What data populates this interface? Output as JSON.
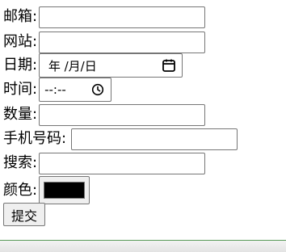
{
  "form": {
    "email_label": "邮箱:",
    "email_value": "",
    "website_label": "网站:",
    "website_value": "",
    "date_label": "日期:",
    "date_display": " 年 /月/日",
    "time_label": "时间:",
    "time_display": "--:--",
    "quantity_label": "数量:",
    "quantity_value": "",
    "phone_label": "手机号码:",
    "phone_value": "",
    "search_label": "搜索:",
    "search_value": "",
    "color_label": "颜色:",
    "color_value": "#000000",
    "submit_label": "提交"
  },
  "icons": {
    "date_picker": "calendar-icon",
    "time_picker": "clock-icon"
  }
}
